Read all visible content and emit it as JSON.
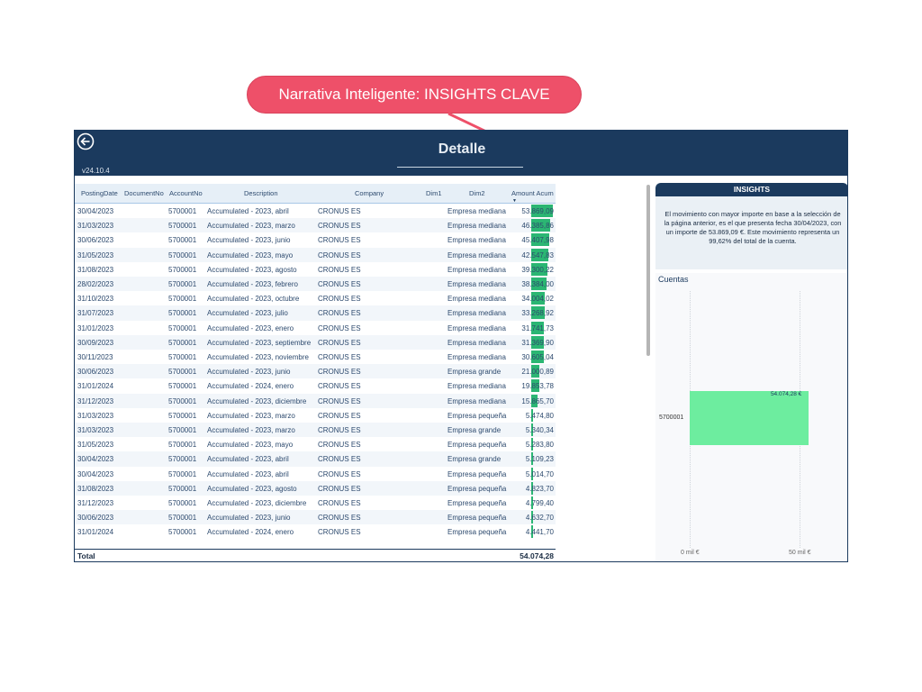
{
  "callout": {
    "label": "Narrativa Inteligente: INSIGHTS CLAVE",
    "color": "#ee5069"
  },
  "header": {
    "title": "Detalle",
    "version": "v24.10.4",
    "back_icon": "arrow-left-circle-icon",
    "color": "#1b3a5e"
  },
  "table": {
    "columns": [
      "PostingDate",
      "DocumentNo",
      "AccountNo",
      "Description",
      "Company",
      "Dim1",
      "Dim2",
      "Amount Acum"
    ],
    "sort_icon": "sort-descending-icon",
    "rows": [
      [
        "30/04/2023",
        "",
        "5700001",
        "Accumulated - 2023, abril",
        "CRONUS ES",
        "",
        "Empresa mediana",
        "53.869,09"
      ],
      [
        "31/03/2023",
        "",
        "5700001",
        "Accumulated - 2023, marzo",
        "CRONUS ES",
        "",
        "Empresa mediana",
        "46.385,86"
      ],
      [
        "30/06/2023",
        "",
        "5700001",
        "Accumulated - 2023, junio",
        "CRONUS ES",
        "",
        "Empresa mediana",
        "45.407,98"
      ],
      [
        "31/05/2023",
        "",
        "5700001",
        "Accumulated - 2023, mayo",
        "CRONUS ES",
        "",
        "Empresa mediana",
        "42.547,83"
      ],
      [
        "31/08/2023",
        "",
        "5700001",
        "Accumulated - 2023, agosto",
        "CRONUS ES",
        "",
        "Empresa mediana",
        "39.300,22"
      ],
      [
        "28/02/2023",
        "",
        "5700001",
        "Accumulated - 2023, febrero",
        "CRONUS ES",
        "",
        "Empresa mediana",
        "38.384,00"
      ],
      [
        "31/10/2023",
        "",
        "5700001",
        "Accumulated - 2023, octubre",
        "CRONUS ES",
        "",
        "Empresa mediana",
        "34.004,02"
      ],
      [
        "31/07/2023",
        "",
        "5700001",
        "Accumulated - 2023, julio",
        "CRONUS ES",
        "",
        "Empresa mediana",
        "33.268,92"
      ],
      [
        "31/01/2023",
        "",
        "5700001",
        "Accumulated - 2023, enero",
        "CRONUS ES",
        "",
        "Empresa mediana",
        "31.741,73"
      ],
      [
        "30/09/2023",
        "",
        "5700001",
        "Accumulated - 2023, septiembre",
        "CRONUS ES",
        "",
        "Empresa mediana",
        "31.369,90"
      ],
      [
        "30/11/2023",
        "",
        "5700001",
        "Accumulated - 2023, noviembre",
        "CRONUS ES",
        "",
        "Empresa mediana",
        "30.605,04"
      ],
      [
        "30/06/2023",
        "",
        "5700001",
        "Accumulated - 2023, junio",
        "CRONUS ES",
        "",
        "Empresa grande",
        "21.000,89"
      ],
      [
        "31/01/2024",
        "",
        "5700001",
        "Accumulated - 2024, enero",
        "CRONUS ES",
        "",
        "Empresa mediana",
        "19.853,78"
      ],
      [
        "31/12/2023",
        "",
        "5700001",
        "Accumulated - 2023, diciembre",
        "CRONUS ES",
        "",
        "Empresa mediana",
        "15.865,70"
      ],
      [
        "31/03/2023",
        "",
        "5700001",
        "Accumulated - 2023, marzo",
        "CRONUS ES",
        "",
        "Empresa pequeña",
        "5.474,80"
      ],
      [
        "31/03/2023",
        "",
        "5700001",
        "Accumulated - 2023, marzo",
        "CRONUS ES",
        "",
        "Empresa grande",
        "5.340,34"
      ],
      [
        "31/05/2023",
        "",
        "5700001",
        "Accumulated - 2023, mayo",
        "CRONUS ES",
        "",
        "Empresa pequeña",
        "5.283,80"
      ],
      [
        "30/04/2023",
        "",
        "5700001",
        "Accumulated - 2023, abril",
        "CRONUS ES",
        "",
        "Empresa grande",
        "5.109,23"
      ],
      [
        "30/04/2023",
        "",
        "5700001",
        "Accumulated - 2023, abril",
        "CRONUS ES",
        "",
        "Empresa pequeña",
        "5.014,70"
      ],
      [
        "31/08/2023",
        "",
        "5700001",
        "Accumulated - 2023, agosto",
        "CRONUS ES",
        "",
        "Empresa pequeña",
        "4.823,70"
      ],
      [
        "31/12/2023",
        "",
        "5700001",
        "Accumulated - 2023, diciembre",
        "CRONUS ES",
        "",
        "Empresa pequeña",
        "4.799,40"
      ],
      [
        "30/06/2023",
        "",
        "5700001",
        "Accumulated - 2023, junio",
        "CRONUS ES",
        "",
        "Empresa pequeña",
        "4.632,70"
      ],
      [
        "31/01/2024",
        "",
        "5700001",
        "Accumulated - 2024, enero",
        "CRONUS ES",
        "",
        "Empresa pequeña",
        "4.441,70"
      ]
    ],
    "amount_bars": [
      53869.09,
      46385.86,
      45407.98,
      42547.83,
      39300.22,
      38384.0,
      34004.02,
      33268.92,
      31741.73,
      31369.9,
      30605.04,
      21000.89,
      19853.78,
      15865.7,
      5474.8,
      5340.34,
      5283.8,
      5109.23,
      5014.7,
      4823.7,
      4799.4,
      4632.7,
      4441.7
    ],
    "total_label": "Total",
    "total_value": "54.074,28",
    "bar_color": "#2bb673"
  },
  "insights": {
    "title": "INSIGHTS",
    "text": "El movimiento con mayor importe en base a la selección de la página anterior, es el que presenta fecha 30/04/2023, con un importe de 53.869,09 €. Este movimiento representa un 99,62% del total de la cuenta."
  },
  "chart_data": {
    "type": "bar",
    "orientation": "horizontal",
    "title": "Cuentas",
    "categories": [
      "5700001"
    ],
    "values": [
      54074.28
    ],
    "value_labels": [
      "54.074,28 €"
    ],
    "x_ticks": [
      "0 mil €",
      "50 mil €"
    ],
    "xlim": [
      0,
      50000
    ],
    "bar_color": "#6ded9f",
    "grid": true
  }
}
